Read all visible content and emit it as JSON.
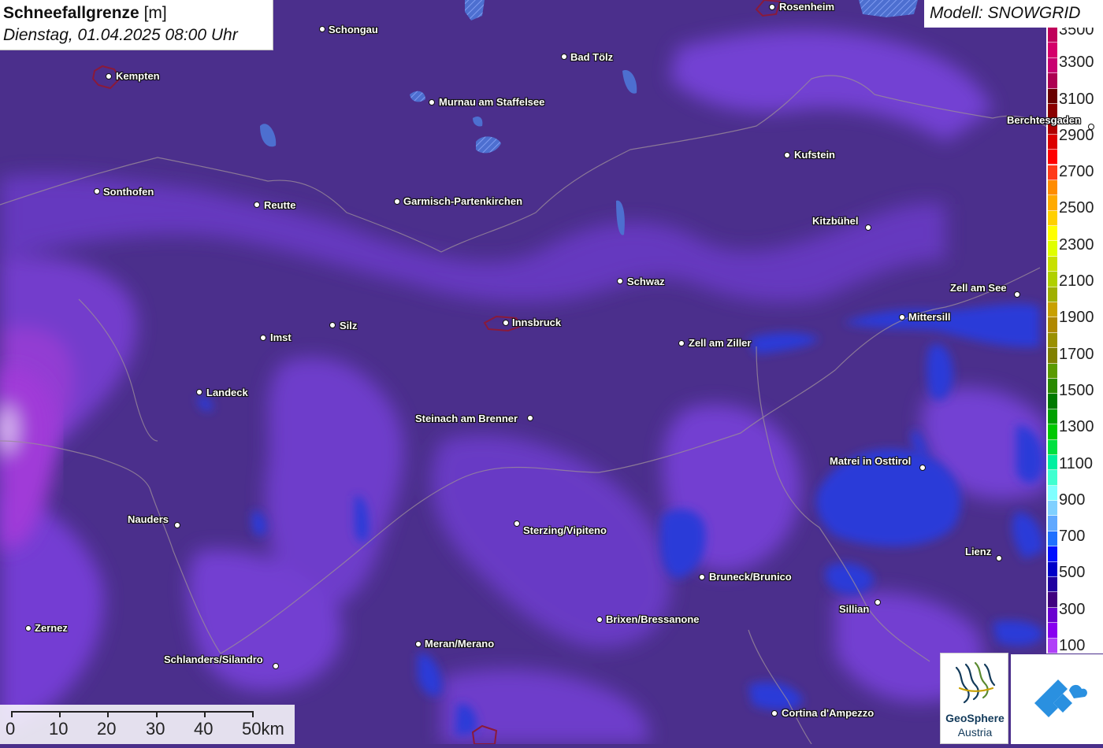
{
  "title": {
    "parameter": "Schneefallgrenze",
    "unit": "[m]",
    "datetime": "Dienstag, 01.04.2025 08:00 Uhr"
  },
  "model": "Modell: SNOWGRID",
  "legend": {
    "labels": [
      "3500",
      "3300",
      "3100",
      "2900",
      "2700",
      "2500",
      "2300",
      "2100",
      "1900",
      "1700",
      "1500",
      "1300",
      "1100",
      "900",
      "700",
      "500",
      "300",
      "100"
    ],
    "colors": [
      "#c0005a",
      "#d4006a",
      "#c80070",
      "#ad0052",
      "#6a0000",
      "#8b0000",
      "#b00000",
      "#dc0000",
      "#ff0000",
      "#ff3a1a",
      "#ff8c00",
      "#ffaa00",
      "#ffd000",
      "#ffff00",
      "#e0ff00",
      "#c8e000",
      "#b0d000",
      "#a0b000",
      "#c8a000",
      "#b08800",
      "#9a9000",
      "#808000",
      "#5a9a00",
      "#2a8a00",
      "#007a00",
      "#00a000",
      "#00c800",
      "#00e040",
      "#00f0a0",
      "#40ffd0",
      "#80ffff",
      "#80d0ff",
      "#60a8ff",
      "#2070ff",
      "#0010ff",
      "#0000c8",
      "#2000a0",
      "#400080",
      "#6a00d0",
      "#8800f0",
      "#b040f8"
    ]
  },
  "cities": [
    {
      "name": "Rosenheim"
    },
    {
      "name": "Schongau"
    },
    {
      "name": "Kempten"
    },
    {
      "name": "Bad Tölz"
    },
    {
      "name": "Murnau am Staffelsee"
    },
    {
      "name": "Berchtesgaden"
    },
    {
      "name": "Kufstein"
    },
    {
      "name": "Sonthofen"
    },
    {
      "name": "Reutte"
    },
    {
      "name": "Garmisch-Partenkirchen"
    },
    {
      "name": "Kitzbühel"
    },
    {
      "name": "Schwaz"
    },
    {
      "name": "Zell am See"
    },
    {
      "name": "Mittersill"
    },
    {
      "name": "Innsbruck"
    },
    {
      "name": "Silz"
    },
    {
      "name": "Imst"
    },
    {
      "name": "Zell am Ziller"
    },
    {
      "name": "Landeck"
    },
    {
      "name": "Steinach am Brenner"
    },
    {
      "name": "Matrei in Osttirol"
    },
    {
      "name": "Nauders"
    },
    {
      "name": "Sterzing/Vipiteno"
    },
    {
      "name": "Lienz"
    },
    {
      "name": "Bruneck/Brunico"
    },
    {
      "name": "Sillian"
    },
    {
      "name": "Zernez"
    },
    {
      "name": "Brixen/Bressanone"
    },
    {
      "name": "Meran/Merano"
    },
    {
      "name": "Schlanders/Silandro"
    },
    {
      "name": "Cortina d'Ampezzo"
    }
  ],
  "scale": {
    "labels": [
      "0",
      "10",
      "20",
      "30",
      "40",
      "50km"
    ]
  },
  "logo": {
    "name_line1": "GeoSphere",
    "name_line2": "Austria"
  }
}
